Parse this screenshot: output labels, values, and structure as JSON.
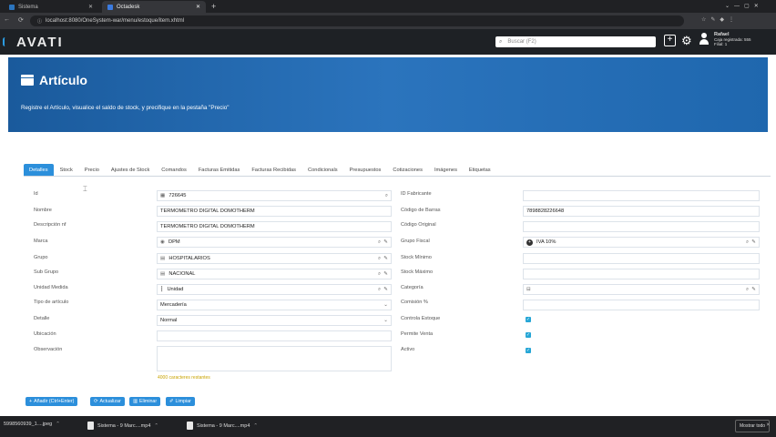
{
  "browser": {
    "tabs": [
      {
        "label": "Sistema",
        "active": false
      },
      {
        "label": "Octadesk",
        "active": true
      }
    ],
    "new_tab_icon": "plus-icon",
    "url": "localhost:8080/OneSystem-war/menu/estoque/item.xhtml"
  },
  "header": {
    "logo": "AVATI",
    "search_placeholder": "Buscar (F2)",
    "user_name": "Rafael",
    "user_line2": "Caja registrada: 555",
    "user_line3": "Filial: 1"
  },
  "hero": {
    "title": "Artículo",
    "subtitle": "Registre el Artículo, visualice el saldo de stock, y precifique en la pestaña \"Precio\""
  },
  "tabs": [
    "Detalles",
    "Stock",
    "Precio",
    "Ajustes de Stock",
    "Comandos",
    "Facturas Emitidas",
    "Facturas Recibidas",
    "Condicionals",
    "Presupuestos",
    "Cotizaciones",
    "Imágenes",
    "Etiquetas"
  ],
  "left": {
    "labels": {
      "id": "Id",
      "nombre": "Nombre",
      "descripcion": "Descripción nf",
      "marca": "Marca",
      "grupo": "Grupo",
      "subgrupo": "Sub Grupo",
      "unidad": "Unidad Medida",
      "tipo": "Tipo de artículo",
      "detalle": "Detalle",
      "ubicacion": "Ubicación",
      "observacion": "Observación"
    },
    "values": {
      "id": "726645",
      "nombre": "TERMOMETRO DIGITAL DOMOTHERM",
      "descripcion": "TERMOMETRO DIGITAL DOMOTHERM",
      "marca": "DPM",
      "grupo": "HOSPITALARIOS",
      "subgrupo": "NACIONAL",
      "unidad": "Unidad",
      "tipo": "Mercadería",
      "detalle": "Normal",
      "chars_remaining": "4000 caracteres restantes"
    }
  },
  "right": {
    "labels": {
      "fabricante": "ID Fabricante",
      "barras": "Código de Barras",
      "original": "Código Original",
      "fiscal": "Grupo Fiscal",
      "min": "Stock Mínimo",
      "max": "Stock Máximo",
      "categoria": "Categoría",
      "comision": "Comisión %",
      "controla": "Controla Estoque",
      "permite": "Permite Venta",
      "activo": "Activo"
    },
    "values": {
      "barras": "7898828226648",
      "fiscal": "IVA 10%"
    }
  },
  "buttons": {
    "add": "Añadir (Ctrl+Enter)",
    "update": "Actualizar",
    "delete": "Eliminar",
    "clear": "Limpiar"
  },
  "taskbar": {
    "items": [
      "5998560939_1....jpeg",
      "Sistema - 9 Marc....mp4",
      "Sistema - 9 Marc....mp4"
    ],
    "show_all": "Mostrar todo"
  },
  "colors": {
    "accent": "#2c8fdb",
    "hero": "#1f67ae",
    "check": "#26a6d6"
  }
}
